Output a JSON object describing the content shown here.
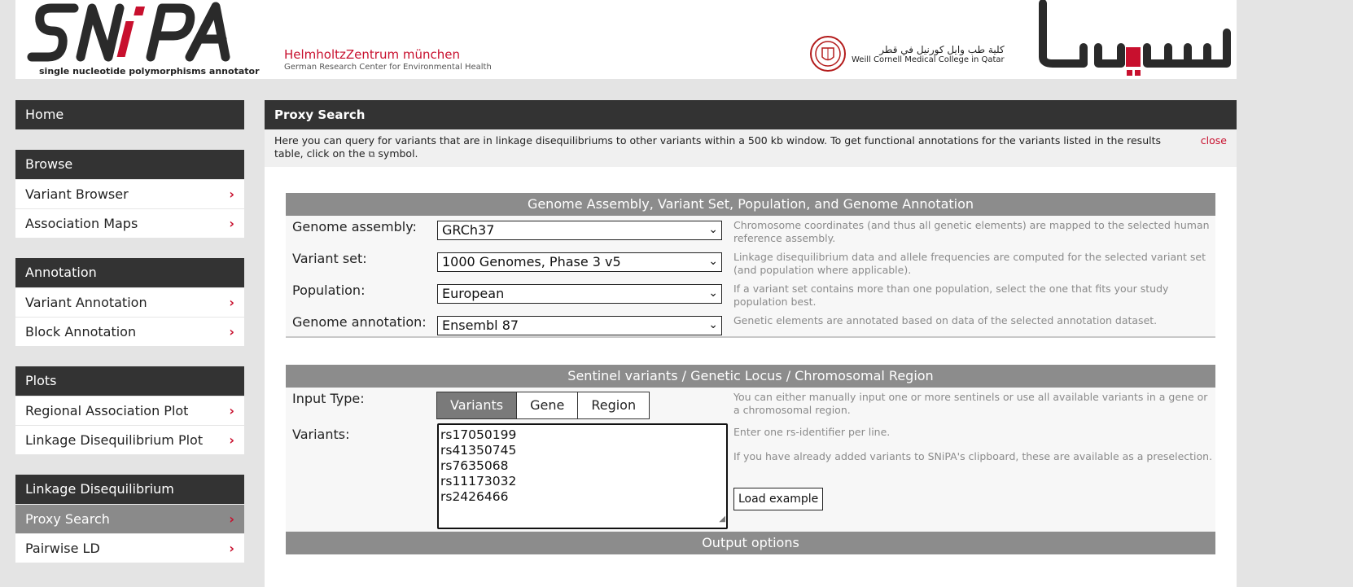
{
  "header": {
    "snipa_tagline": "single nucleotide polymorphisms annotator",
    "helmholtz_name": "HelmholtzZentrum münchen",
    "helmholtz_sub": "German Research Center for Environmental Health",
    "weill_arabic": "كلية طب وايل كورنيل في قطر",
    "weill_name": "Weill Cornell Medical College in Qatar"
  },
  "sidebar": {
    "home": "Home",
    "sections": [
      {
        "title": "Browse",
        "items": [
          "Variant Browser",
          "Association Maps"
        ]
      },
      {
        "title": "Annotation",
        "items": [
          "Variant Annotation",
          "Block Annotation"
        ]
      },
      {
        "title": "Plots",
        "items": [
          "Regional Association Plot",
          "Linkage Disequilibrium Plot"
        ]
      },
      {
        "title": "Linkage Disequilibrium",
        "items": [
          "Proxy Search",
          "Pairwise LD"
        ]
      }
    ],
    "active_item": "Proxy Search"
  },
  "main": {
    "title": "Proxy Search",
    "intro_text": "Here you can query for variants that are in linkage disequilibriums to other variants within a 500 kb window. To get functional annotations for the variants listed in the results table, click on the",
    "intro_text_end": "symbol.",
    "close_label": "close",
    "assembly_panel": {
      "title": "Genome Assembly, Variant Set, Population, and Genome Annotation",
      "rows": [
        {
          "label": "Genome assembly:",
          "value": "GRCh37",
          "hint": "Chromosome coordinates (and thus all genetic elements) are mapped to the selected human reference assembly."
        },
        {
          "label": "Variant set:",
          "value": "1000 Genomes, Phase 3 v5",
          "hint": "Linkage disequilibrium data and allele frequencies are computed for the selected variant set (and population where applicable)."
        },
        {
          "label": "Population:",
          "value": "European",
          "hint": "If a variant set contains more than one population, select the one that fits your study population best."
        },
        {
          "label": "Genome annotation:",
          "value": "Ensembl 87",
          "hint": "Genetic elements are annotated based on data of the selected annotation dataset."
        }
      ]
    },
    "sentinel_panel": {
      "title": "Sentinel variants / Genetic Locus / Chromosomal Region",
      "input_type_label": "Input Type:",
      "input_types": [
        "Variants",
        "Gene",
        "Region"
      ],
      "input_type_selected": "Variants",
      "input_type_hint": "You can either manually input one or more sentinels or use all available variants in a gene or a chromosomal region.",
      "variants_label": "Variants:",
      "variants": [
        "rs17050199",
        "rs41350745",
        "rs7635068",
        "rs11173032",
        "rs2426466"
      ],
      "variants_hint_1": "Enter one rs-identifier per line.",
      "variants_hint_2": "If you have already added variants to SNiPA's clipboard, these are available as a preselection.",
      "load_example_label": "Load example"
    },
    "output_panel": {
      "title": "Output options"
    }
  }
}
